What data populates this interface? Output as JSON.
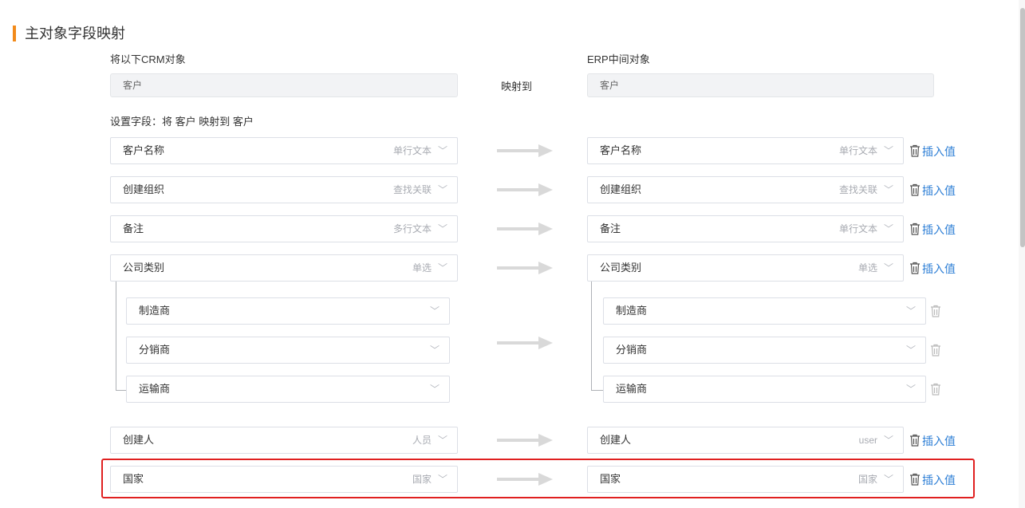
{
  "section": {
    "title": "主对象字段映射"
  },
  "source": {
    "label": "将以下CRM对象",
    "value": "客户"
  },
  "target": {
    "label": "ERP中间对象",
    "value": "客户"
  },
  "map_to_label": "映射到",
  "setting_label": "设置字段：将 客户 映射到 客户",
  "insert_label": "插入值",
  "rows": [
    {
      "left_name": "客户名称",
      "left_type": "单行文本",
      "right_name": "客户名称",
      "right_type": "单行文本"
    },
    {
      "left_name": "创建组织",
      "left_type": "查找关联",
      "right_name": "创建组织",
      "right_type": "查找关联"
    },
    {
      "left_name": "备注",
      "left_type": "多行文本",
      "right_name": "备注",
      "right_type": "单行文本"
    },
    {
      "left_name": "公司类别",
      "left_type": "单选",
      "right_name": "公司类别",
      "right_type": "单选"
    },
    {
      "left_name": "创建人",
      "left_type": "人员",
      "right_name": "创建人",
      "right_type": "user"
    },
    {
      "left_name": "国家",
      "left_type": "国家",
      "right_name": "国家",
      "right_type": "国家"
    }
  ],
  "options": [
    {
      "left": "制造商",
      "right": "制造商"
    },
    {
      "left": "分销商",
      "right": "分销商"
    },
    {
      "left": "运输商",
      "right": "运输商"
    }
  ],
  "icons": {
    "arrow": "arrow-right-icon",
    "trash": "trash-icon",
    "chevron": "chevron-down-icon"
  },
  "colors": {
    "accent": "#f28a1a",
    "link": "#2e7fd6",
    "highlight": "#e02020"
  }
}
